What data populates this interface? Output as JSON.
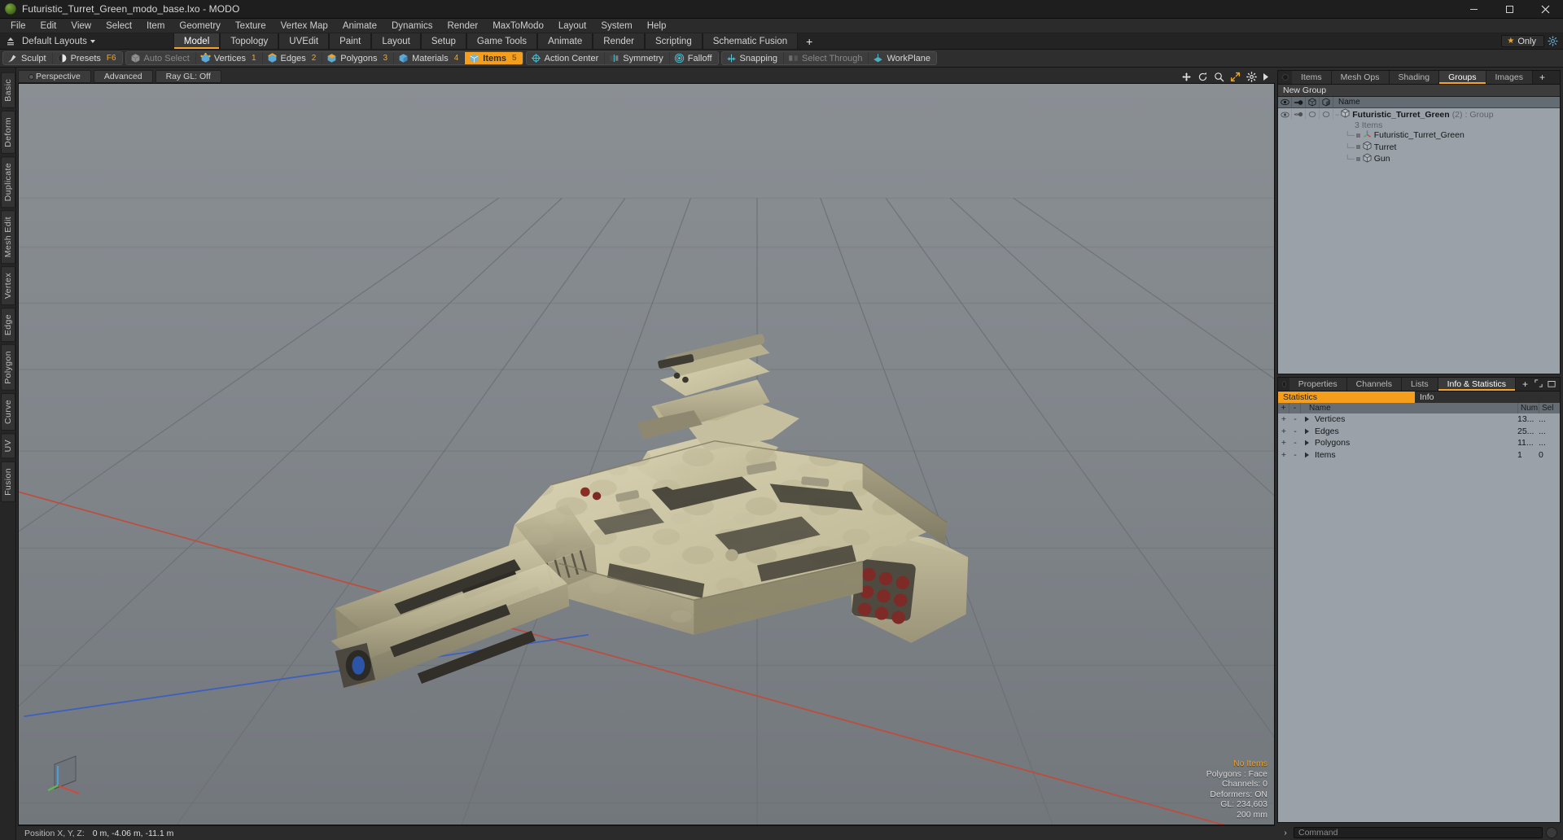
{
  "titlebar": {
    "title": "Futuristic_Turret_Green_modo_base.lxo - MODO",
    "logo_icon": "modo-logo-icon",
    "minimize": "–",
    "maximize": "☐",
    "close": "✕"
  },
  "menubar": {
    "items": [
      "File",
      "Edit",
      "View",
      "Select",
      "Item",
      "Geometry",
      "Texture",
      "Vertex Map",
      "Animate",
      "Dynamics",
      "Render",
      "MaxToModo",
      "Layout",
      "System",
      "Help"
    ]
  },
  "layoutbar": {
    "hamburger_icon": "layout-menu-icon",
    "default_layouts": "Default Layouts",
    "tabs": [
      {
        "label": "Model",
        "active": true
      },
      {
        "label": "Topology",
        "active": false
      },
      {
        "label": "UVEdit",
        "active": false
      },
      {
        "label": "Paint",
        "active": false
      },
      {
        "label": "Layout",
        "active": false
      },
      {
        "label": "Setup",
        "active": false
      },
      {
        "label": "Game Tools",
        "active": false
      },
      {
        "label": "Animate",
        "active": false
      },
      {
        "label": "Render",
        "active": false
      },
      {
        "label": "Scripting",
        "active": false
      },
      {
        "label": "Schematic Fusion",
        "active": false
      }
    ],
    "add_tab": "+",
    "only_label": "Only",
    "star_icon": "star-icon",
    "gear_icon": "gear-icon"
  },
  "modebar": {
    "groups": [
      {
        "buttons": [
          {
            "label": "Sculpt",
            "icon": "sculpt-brush-icon",
            "state": "normal",
            "badge": ""
          },
          {
            "label": "Presets",
            "icon": "presets-sphere-icon",
            "state": "normal",
            "badge": "F6"
          }
        ]
      },
      {
        "buttons": [
          {
            "label": "Auto Select",
            "icon": "auto-select-cube-icon",
            "state": "dim",
            "badge": ""
          },
          {
            "label": "Vertices",
            "icon": "vertices-cube-icon",
            "state": "normal",
            "badge": "1"
          },
          {
            "label": "Edges",
            "icon": "edges-cube-icon",
            "state": "normal",
            "badge": "2"
          },
          {
            "label": "Polygons",
            "icon": "polygons-cube-icon",
            "state": "normal",
            "badge": "3"
          },
          {
            "label": "Materials",
            "icon": "materials-cube-icon",
            "state": "normal",
            "badge": "4"
          },
          {
            "label": "Items",
            "icon": "items-cube-icon",
            "state": "active",
            "badge": "5"
          }
        ]
      },
      {
        "buttons": [
          {
            "label": "Action Center",
            "icon": "action-center-icon",
            "state": "normal",
            "badge": ""
          },
          {
            "label": "Symmetry",
            "icon": "symmetry-icon",
            "state": "normal",
            "badge": ""
          },
          {
            "label": "Falloff",
            "icon": "falloff-icon",
            "state": "normal",
            "badge": ""
          }
        ]
      },
      {
        "buttons": [
          {
            "label": "Snapping",
            "icon": "snapping-icon",
            "state": "normal",
            "badge": ""
          },
          {
            "label": "Select Through",
            "icon": "select-through-icon",
            "state": "dim",
            "badge": ""
          },
          {
            "label": "WorkPlane",
            "icon": "workplane-icon",
            "state": "normal",
            "badge": ""
          }
        ]
      }
    ]
  },
  "vstrip": {
    "tabs": [
      "Basic",
      "Deform",
      "Duplicate",
      "Mesh Edit",
      "Vertex",
      "Edge",
      "Polygon",
      "Curve",
      "UV",
      "Fusion"
    ]
  },
  "viewport": {
    "tabs": [
      {
        "label": "Perspective",
        "has_dot": true
      },
      {
        "label": "Advanced",
        "has_dot": false
      },
      {
        "label": "Ray GL: Off",
        "has_dot": false
      }
    ],
    "header_icons": [
      "move-icon",
      "rotate-icon",
      "zoom-icon",
      "fit-icon",
      "gear-icon",
      "chevron-right-icon"
    ],
    "info": {
      "no_items": "No Items",
      "polygons": "Polygons : Face",
      "channels": "Channels: 0",
      "deformers": "Deformers: ON",
      "gl": "GL: 234,603",
      "scale": "200 mm"
    },
    "axis_gizmo_icon": "axis-gizmo-icon"
  },
  "statusbar": {
    "position_label": "Position X, Y, Z:",
    "position_value": "0 m, -4.06 m, -11.1 m"
  },
  "groups_panel": {
    "tabs": [
      {
        "label": "Items",
        "active": false
      },
      {
        "label": "Mesh Ops",
        "active": false
      },
      {
        "label": "Shading",
        "active": false
      },
      {
        "label": "Groups",
        "active": true
      },
      {
        "label": "Images",
        "active": false
      }
    ],
    "add_tab": "+",
    "group_name": "New Group",
    "column_headers": [
      {
        "icon": "eye-icon"
      },
      {
        "icon": "render-visibility-icon"
      },
      {
        "icon": "wireframe-cube-icon"
      },
      {
        "icon": "shaded-cube-icon"
      }
    ],
    "name_header": "Name",
    "tree": [
      {
        "label": "Futuristic_Turret_Green",
        "count": "(2)",
        "type": ": Group",
        "sub": "3 Items",
        "icon": "group-cube-icon",
        "level": 0
      },
      {
        "label": "Futuristic_Turret_Green",
        "icon": "locator-axis-icon",
        "level": 1
      },
      {
        "label": "Turret",
        "icon": "mesh-cube-icon",
        "level": 1
      },
      {
        "label": "Gun",
        "icon": "mesh-cube-icon",
        "level": 1
      }
    ]
  },
  "stats_panel": {
    "tabs": [
      {
        "label": "Properties",
        "active": false
      },
      {
        "label": "Channels",
        "active": false
      },
      {
        "label": "Lists",
        "active": false
      },
      {
        "label": "Info & Statistics",
        "active": true
      }
    ],
    "add_tab": "+",
    "expand_icon": "expand-icon",
    "popout_icon": "popout-icon",
    "subtabs": [
      {
        "label": "Statistics",
        "active": true
      },
      {
        "label": "Info",
        "active": false
      }
    ],
    "headers": {
      "plus": "+",
      "minus": "-",
      "name": "Name",
      "num": "Num",
      "sel": "Sel"
    },
    "rows": [
      {
        "name": "Vertices",
        "num": "13...",
        "sel": "..."
      },
      {
        "name": "Edges",
        "num": "25...",
        "sel": "..."
      },
      {
        "name": "Polygons",
        "num": "11...",
        "sel": "..."
      },
      {
        "name": "Items",
        "num": "1",
        "sel": "0"
      }
    ]
  },
  "commandbar": {
    "arrow": "›",
    "placeholder": "Command"
  },
  "colors": {
    "accent": "#f49e1b",
    "panel_bg": "#2f2f2f",
    "tree_bg": "#9aa1a8",
    "viewport_bg": "#7d8287"
  }
}
